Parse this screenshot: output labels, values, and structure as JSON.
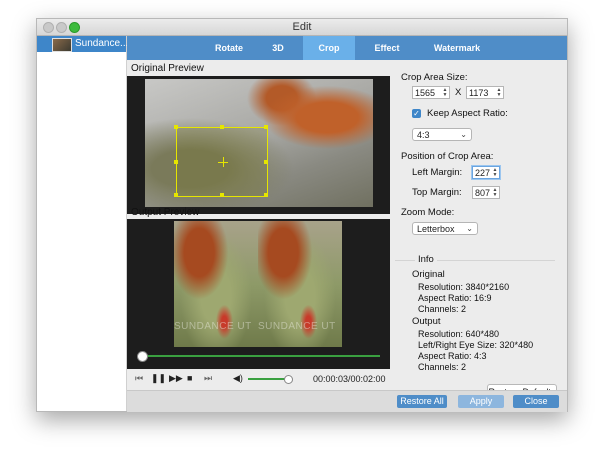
{
  "window": {
    "title": "Edit"
  },
  "sidebar": {
    "items": [
      {
        "label": "Sundance..."
      }
    ]
  },
  "tabs": [
    {
      "label": "Rotate"
    },
    {
      "label": "3D"
    },
    {
      "label": "Crop"
    },
    {
      "label": "Effect"
    },
    {
      "label": "Watermark"
    }
  ],
  "active_tab": "Crop",
  "preview": {
    "original_label": "Original Preview",
    "output_label": "Output Preview",
    "watermark_text": "SUNDANCE UT"
  },
  "player": {
    "timecode": "00:00:03/00:02:00",
    "progress_fraction": 0.02,
    "volume_fraction": 0.9
  },
  "crop": {
    "area_size_label": "Crop Area Size:",
    "width": "1565",
    "x_label": "X",
    "height": "1173",
    "keep_aspect_label": "Keep Aspect Ratio:",
    "keep_aspect_checked": true,
    "aspect_value": "4:3",
    "position_label": "Position of Crop Area:",
    "left_margin_label": "Left Margin:",
    "left_margin": "227",
    "top_margin_label": "Top Margin:",
    "top_margin": "807",
    "zoom_label": "Zoom Mode:",
    "zoom_value": "Letterbox"
  },
  "info": {
    "title": "Info",
    "original_title": "Original",
    "original_resolution": "Resolution: 3840*2160",
    "original_aspect": "Aspect Ratio: 16:9",
    "original_channels": "Channels: 2",
    "output_title": "Output",
    "output_resolution": "Resolution: 640*480",
    "output_eye_size": "Left/Right Eye Size: 320*480",
    "output_aspect": "Aspect Ratio: 4:3",
    "output_channels": "Channels: 2"
  },
  "buttons": {
    "restore_defaults": "Restore Defaults",
    "restore_all": "Restore All",
    "apply": "Apply",
    "close": "Close"
  },
  "colors": {
    "accent": "#4f8dc8",
    "active_tab": "#6ab0e9",
    "crop_box": "#e6e600",
    "progress": "#3aa040"
  }
}
